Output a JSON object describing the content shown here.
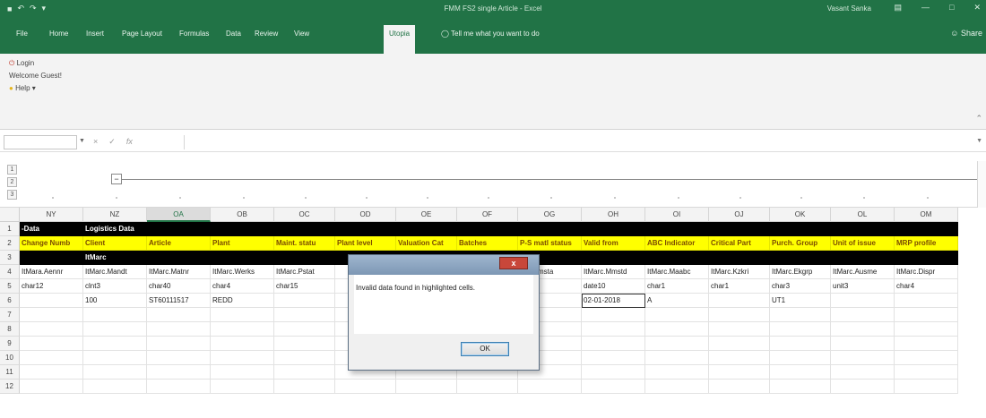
{
  "window": {
    "title": "FMM FS2 single Article - Excel",
    "user": "Vasant Sanka",
    "qat_icons": [
      "save-icon",
      "undo-icon",
      "redo-icon",
      "customize-icon"
    ],
    "window_icons": [
      "ribbon-display-icon",
      "minimize-icon",
      "restore-icon",
      "close-icon"
    ]
  },
  "ribbon": {
    "tabs": [
      {
        "label": "File"
      },
      {
        "label": "Home"
      },
      {
        "label": "Insert"
      },
      {
        "label": "Page Layout"
      },
      {
        "label": "Formulas"
      },
      {
        "label": "Data"
      },
      {
        "label": "Review"
      },
      {
        "label": "View"
      },
      {
        "label": "Utopia",
        "active": true
      }
    ],
    "tell_me": "Tell me what you want to do",
    "share": "Share",
    "items": {
      "login": "Login",
      "welcome": "Welcome Guest!",
      "help": "Help"
    }
  },
  "formula_bar": {
    "name_box": "",
    "cancel_icon": "×",
    "enter_icon": "✓",
    "fx_label": "fx",
    "value": ""
  },
  "outline": {
    "levels": [
      "1",
      "2",
      "3"
    ],
    "collapse_symbol": "−"
  },
  "sheet": {
    "columns": [
      {
        "id": "NY",
        "label": "NY"
      },
      {
        "id": "NZ",
        "label": "NZ"
      },
      {
        "id": "OA",
        "label": "OA",
        "selected": true
      },
      {
        "id": "OB",
        "label": "OB"
      },
      {
        "id": "OC",
        "label": "OC"
      },
      {
        "id": "OD",
        "label": "OD"
      },
      {
        "id": "OE",
        "label": "OE"
      },
      {
        "id": "OF",
        "label": "OF"
      },
      {
        "id": "OG",
        "label": "OG"
      },
      {
        "id": "OH",
        "label": "OH"
      },
      {
        "id": "OI",
        "label": "OI"
      },
      {
        "id": "OJ",
        "label": "OJ"
      },
      {
        "id": "OK",
        "label": "OK"
      },
      {
        "id": "OL",
        "label": "OL"
      },
      {
        "id": "OM",
        "label": "OM"
      }
    ],
    "row_numbers": [
      "1",
      "2",
      "3",
      "4",
      "5",
      "6",
      "7",
      "8",
      "9",
      "10",
      "11",
      "12"
    ],
    "rows": [
      {
        "style": "bk",
        "cells": [
          "-Data",
          "Logistics Data",
          "",
          "",
          "",
          "",
          "",
          "",
          "",
          "",
          "",
          "",
          "",
          "",
          ""
        ]
      },
      {
        "style": "yl",
        "cells": [
          "Change Numb",
          "Client",
          "Article",
          "Plant",
          "Maint. statu",
          "Plant level",
          "Valuation Cat",
          "Batches",
          "P-S matl status",
          "Valid from",
          "ABC Indicator",
          "Critical Part",
          "Purch. Group",
          "Unit of issue",
          "MRP profile"
        ]
      },
      {
        "style": "bk",
        "cells": [
          "",
          "ItMarc",
          "",
          "",
          "",
          "",
          "",
          "",
          "",
          "",
          "",
          "",
          "",
          "",
          ""
        ]
      },
      {
        "style": "",
        "cells": [
          "ItMara.Aennr",
          "ItMarc.Mandt",
          "ItMarc.Matnr",
          "ItMarc.Werks",
          "ItMarc.Pstat",
          "",
          "",
          "",
          "arc.Mmsta",
          "ItMarc.Mmstd",
          "ItMarc.Maabc",
          "ItMarc.Kzkri",
          "ItMarc.Ekgrp",
          "ItMarc.Ausme",
          "ItMarc.Dispr"
        ]
      },
      {
        "style": "",
        "cells": [
          "char12",
          "clnt3",
          "char40",
          "char4",
          "char15",
          "",
          "",
          "",
          "r2",
          "date10",
          "char1",
          "char1",
          "char3",
          "unit3",
          "char4"
        ]
      },
      {
        "style": "",
        "cells": [
          "",
          "100",
          "ST60111517",
          "REDD",
          "",
          "",
          "",
          "",
          "",
          "02-01-2018",
          "A",
          "",
          "UT1",
          "",
          ""
        ]
      },
      {
        "style": "",
        "cells": [
          "",
          "",
          "",
          "",
          "",
          "",
          "",
          "",
          "",
          "",
          "",
          "",
          "",
          "",
          ""
        ]
      },
      {
        "style": "",
        "cells": [
          "",
          "",
          "",
          "",
          "",
          "",
          "",
          "",
          "",
          "",
          "",
          "",
          "",
          "",
          ""
        ]
      },
      {
        "style": "",
        "cells": [
          "",
          "",
          "",
          "",
          "",
          "",
          "",
          "",
          "",
          "",
          "",
          "",
          "",
          "",
          ""
        ]
      },
      {
        "style": "",
        "cells": [
          "",
          "",
          "",
          "",
          "",
          "",
          "",
          "",
          "",
          "",
          "",
          "",
          "",
          "",
          ""
        ]
      },
      {
        "style": "",
        "cells": [
          "",
          "",
          "",
          "",
          "",
          "",
          "",
          "",
          "",
          "",
          "",
          "",
          "",
          "",
          ""
        ]
      },
      {
        "style": "",
        "cells": [
          "",
          "",
          "",
          "",
          "",
          "",
          "",
          "",
          "",
          "",
          "",
          "",
          "",
          "",
          ""
        ]
      }
    ],
    "active_cell": {
      "row": 6,
      "col": "OH"
    }
  },
  "dialog": {
    "close_label": "x",
    "message": "Invalid data found in highlighted cells.",
    "ok_label": "OK"
  },
  "colors": {
    "excel_green": "#217346",
    "header_row_bg": "#000000",
    "label_row_bg": "#ffff00"
  }
}
